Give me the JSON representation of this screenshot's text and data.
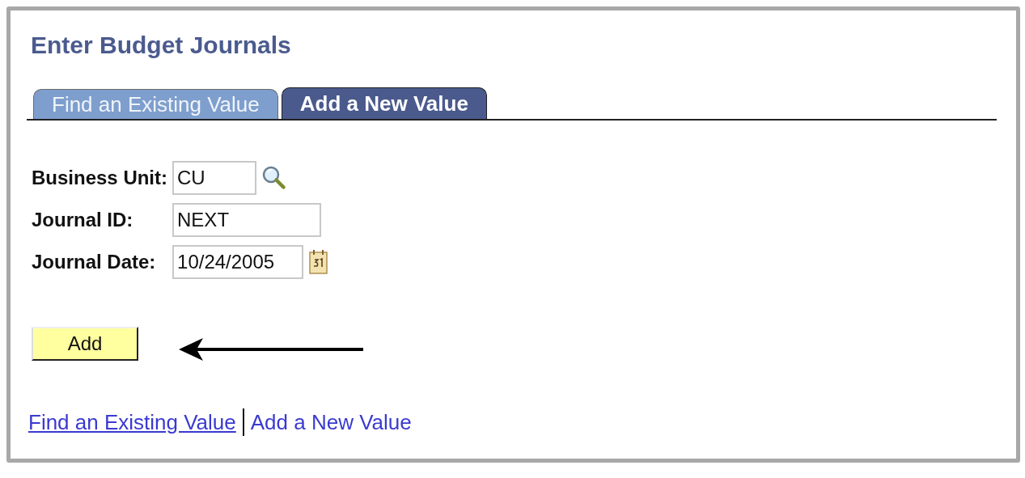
{
  "page": {
    "title": "Enter Budget Journals"
  },
  "tabs": [
    {
      "label": "Find an Existing Value",
      "selected": false
    },
    {
      "label": "Add a New Value",
      "selected": true
    }
  ],
  "fields": [
    {
      "label": "Business Unit:",
      "value": "CU",
      "kind": "lookup"
    },
    {
      "label": "Journal ID:",
      "value": "NEXT",
      "kind": "text"
    },
    {
      "label": "Journal Date:",
      "value": "10/24/2005",
      "kind": "date"
    }
  ],
  "add_button": {
    "label": "Add"
  },
  "links": [
    {
      "label": "Find an Existing Value",
      "selected": false
    },
    {
      "label": "Add a New Value",
      "selected": true
    }
  ]
}
